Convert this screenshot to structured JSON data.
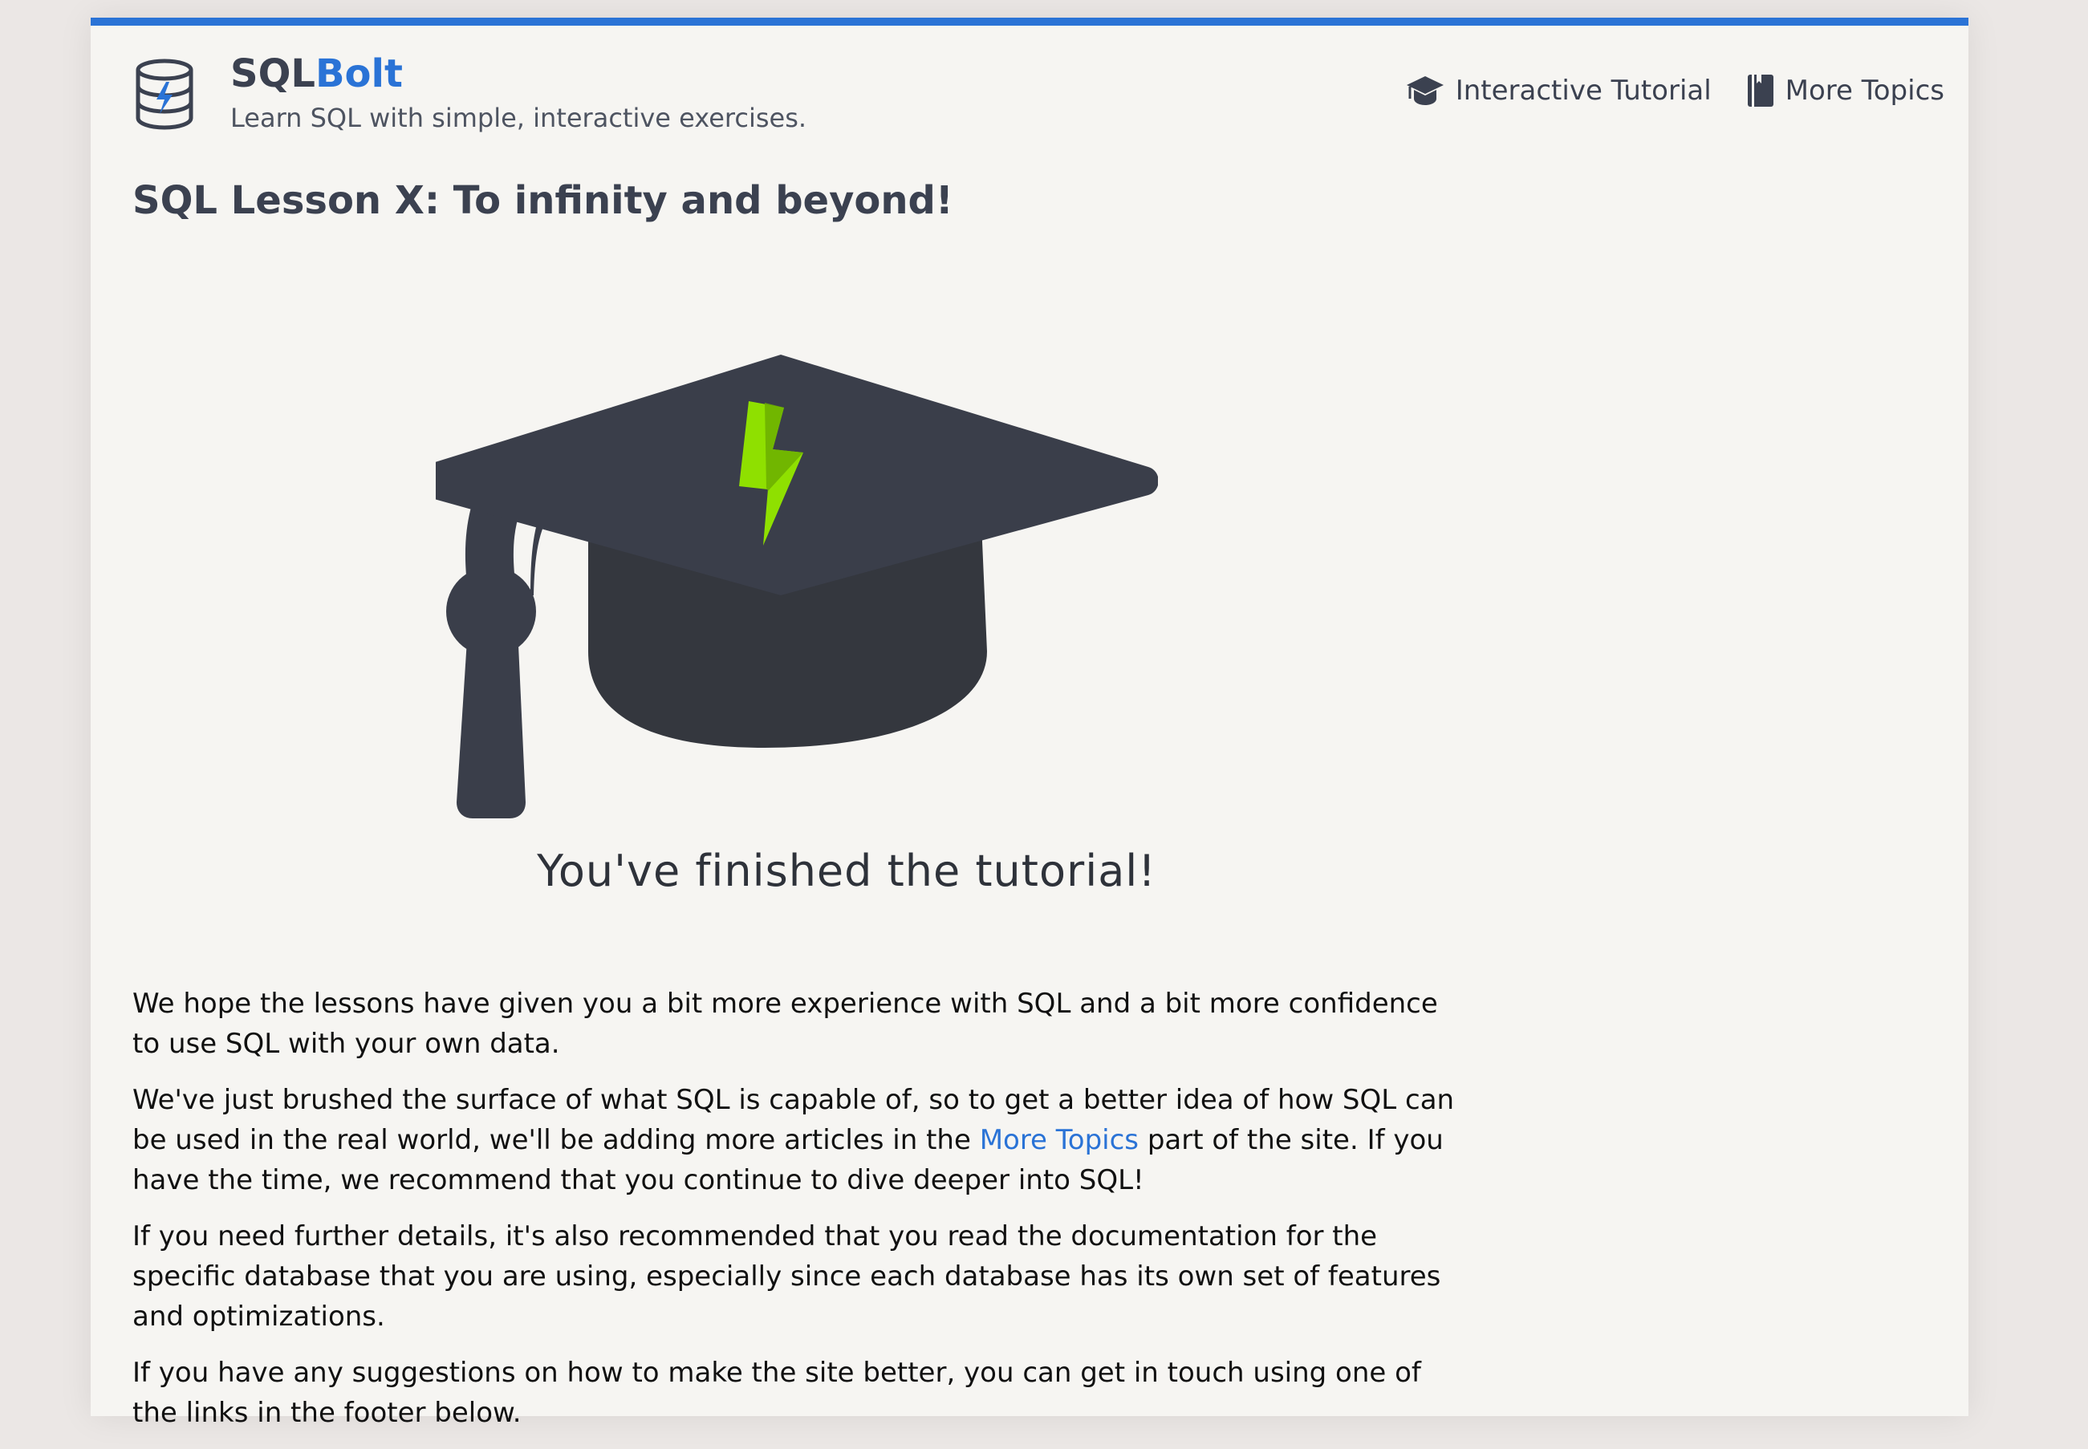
{
  "header": {
    "brand_part1": "SQL",
    "brand_part2": "Bolt",
    "tagline": "Learn SQL with simple, interactive exercises.",
    "nav": {
      "tutorial": "Interactive Tutorial",
      "topics": "More Topics"
    }
  },
  "lesson": {
    "title": "SQL Lesson X: To infinity and beyond!",
    "finished_caption": "You've finished the tutorial!",
    "paragraphs": {
      "p1": "We hope the lessons have given you a bit more experience with SQL and a bit more confidence to use SQL with your own data.",
      "p2_before": "We've just brushed the surface of what SQL is capable of, so to get a better idea of how SQL can be used in the real world, we'll be adding more articles in the ",
      "p2_link": "More Topics",
      "p2_after": " part of the site. If you have the time, we recommend that you continue to dive deeper into SQL!",
      "p3": "If you need further details, it's also recommended that you read the documentation for the specific database that you are using, especially since each database has its own set of features and optimizations.",
      "p4": "If you have any suggestions on how to make the site better, you can get in touch using one of the links in the footer below."
    }
  },
  "colors": {
    "accent": "#2a73d6",
    "cap": "#3a3e4a",
    "bolt": "#8fe000"
  },
  "icons": {
    "logo": "database-bolt-icon",
    "tutorial": "graduation-cap-icon",
    "topics": "book-icon"
  }
}
